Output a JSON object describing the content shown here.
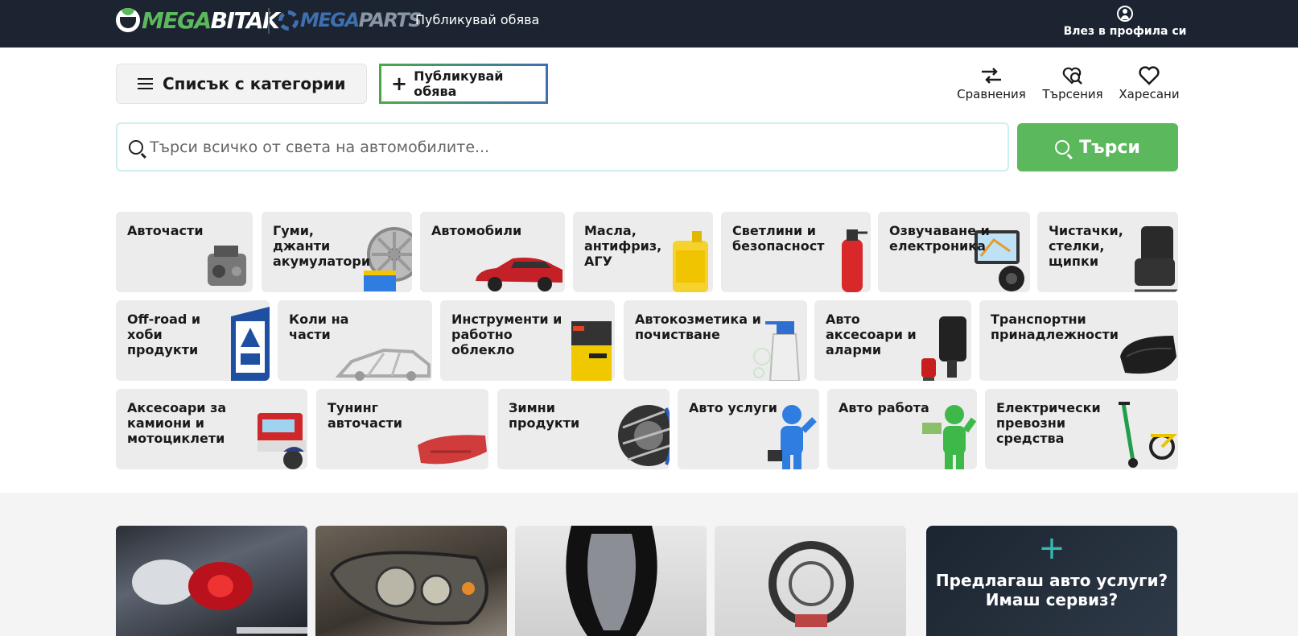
{
  "header": {
    "logo_mega": "MEGA",
    "logo_bitak": "BITAK",
    "logo_parts_mega": "MEGA",
    "logo_parts_parts": "PARTS",
    "publish_link": "Публикувай обява",
    "login_label": "Влез в профила си"
  },
  "toolbar": {
    "categories_label": "Списък с категории",
    "publish_label": "Публикувай обява",
    "compare_label": "Сравнения",
    "searches_label": "Търсения",
    "favorites_label": "Харесани"
  },
  "search": {
    "placeholder": "Търси всичко от света на автомобилите...",
    "button_label": "Търси"
  },
  "categories": [
    {
      "label": "Авточасти"
    },
    {
      "label": "Гуми,\nджанти\nакумулатори"
    },
    {
      "label": "Автомобили"
    },
    {
      "label": "Масла,\nантифриз,\nАГУ"
    },
    {
      "label": "Светлини и\nбезопасност"
    },
    {
      "label": "Озвучаване и\nелектроника"
    },
    {
      "label": "Чистачки,\nстелки,\nщипки"
    },
    {
      "label": "Off-road и\nхоби\nпродукти"
    },
    {
      "label": "Коли на\nчасти"
    },
    {
      "label": "Инструменти и\nработно\nоблекло"
    },
    {
      "label": "Автокозметика и\nпочистване"
    },
    {
      "label": "Авто\nаксесоари и\nаларми"
    },
    {
      "label": "Транспортни\nпринадлежности"
    },
    {
      "label": "Аксесоари за\nкамиони и\nмотоциклети"
    },
    {
      "label": "Тунинг\nавточасти"
    },
    {
      "label": "Зимни\nпродукти"
    },
    {
      "label": "Авто услуги"
    },
    {
      "label": "Авто работа"
    },
    {
      "label": "Електрически\nпревозни\nсредства"
    }
  ],
  "promo": {
    "text": "Предлагаш авто услуги?\nИмаш сервиз?"
  },
  "colors": {
    "topbar": "#1b2430",
    "accent_green": "#5cb85c",
    "accent_blue": "#3f6fb0",
    "tile_bg": "#ececec"
  }
}
